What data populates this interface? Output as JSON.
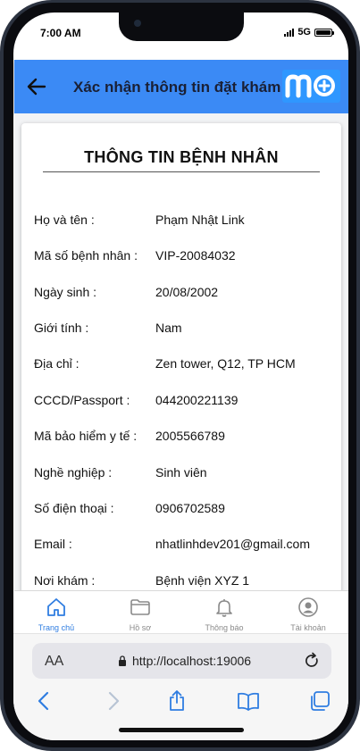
{
  "status": {
    "time": "7:00 AM",
    "network": "5G"
  },
  "header": {
    "title": "Xác nhận thông tin đặt khám",
    "logo_text": "MO"
  },
  "card": {
    "title": "THÔNG TIN BỆNH NHÂN",
    "rows": [
      {
        "label": "Họ và tên :",
        "value": "Phạm Nhật Link"
      },
      {
        "label": "Mã số bệnh nhân :",
        "value": "VIP-20084032"
      },
      {
        "label": "Ngày sinh :",
        "value": "20/08/2002"
      },
      {
        "label": "Giới tính :",
        "value": "Nam"
      },
      {
        "label": "Địa chỉ :",
        "value": "Zen tower, Q12, TP HCM"
      },
      {
        "label": "CCCD/Passport :",
        "value": "044200221139"
      },
      {
        "label": "Mã bảo hiểm y tế :",
        "value": "2005566789"
      },
      {
        "label": "Nghề nghiệp :",
        "value": "Sinh viên"
      },
      {
        "label": "Số điện thoại :",
        "value": "0906702589"
      },
      {
        "label": "Email :",
        "value": "nhatlinhdev201@gmail.com"
      },
      {
        "label": "Nơi khám :",
        "value": "Bệnh viện XYZ 1"
      }
    ]
  },
  "nav": {
    "items": [
      {
        "label": "Trang chủ",
        "icon": "home-icon",
        "active": true
      },
      {
        "label": "Hồ sơ",
        "icon": "folder-icon",
        "active": false
      },
      {
        "label": "Thông báo",
        "icon": "bell-icon",
        "active": false
      },
      {
        "label": "Tài khoản",
        "icon": "user-icon",
        "active": false
      }
    ]
  },
  "browser": {
    "text_size_label": "AA",
    "url": "http://localhost:19006"
  },
  "colors": {
    "header": "#3b8af5",
    "active_nav": "#2f7de1",
    "logo_bg": "#2f97ff"
  }
}
